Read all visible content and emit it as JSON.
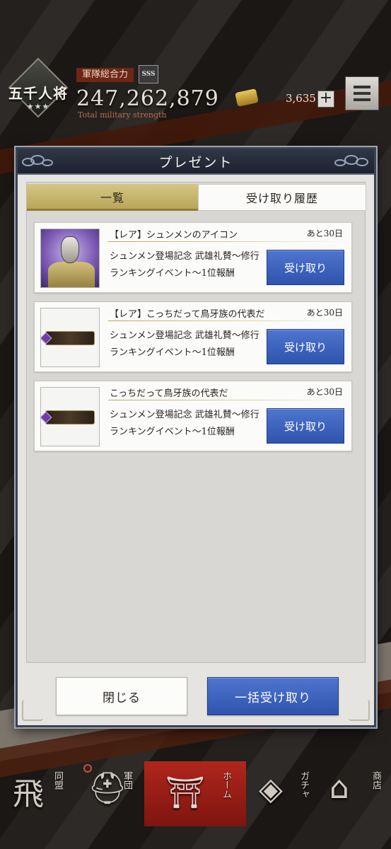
{
  "hud": {
    "rank": "五千人将",
    "rank_stars": "★★★",
    "power_label": "軍隊総合力",
    "power_grade": "SSS",
    "power_value": "247,262,879",
    "power_sub": "Total military strength",
    "coin_count": "3,635",
    "plus": "+"
  },
  "modal": {
    "title": "プレゼント",
    "tabs": [
      {
        "label": "一覧",
        "active": true
      },
      {
        "label": "受け取り履歴",
        "active": false
      }
    ],
    "items": [
      {
        "title": "【レア】シュンメンのアイコン",
        "expire": "あと30日",
        "desc": "シュンメン登場記念 武雄礼賛～修行ランキングイベント～1位報酬",
        "button": "受け取り",
        "thumb": "avatar-icon"
      },
      {
        "title": "【レア】こっちだって鳥牙族の代表だ",
        "expire": "あと30日",
        "desc": "シュンメン登場記念 武雄礼賛～修行ランキングイベント～1位報酬",
        "button": "受け取り",
        "thumb": "title-plate-icon"
      },
      {
        "title": "こっちだって鳥牙族の代表だ",
        "expire": "あと30日",
        "desc": "シュンメン登場記念 武雄礼賛～修行ランキングイベント～1位報酬",
        "button": "受け取り",
        "thumb": "title-plate-icon"
      }
    ],
    "close_label": "閉じる",
    "claim_all_label": "一括受け取り"
  },
  "nav": {
    "items": [
      {
        "label": "同盟",
        "icon": "flying-kanji-icon"
      },
      {
        "label": "軍団",
        "icon": "helmet-icon"
      },
      {
        "label": "ホーム",
        "icon": "palace-icon"
      },
      {
        "label": "ガチャ",
        "icon": "diamond-crest-icon"
      },
      {
        "label": "商店",
        "icon": "shop-building-icon"
      }
    ]
  },
  "colors": {
    "accent_blue": "#3a60bb",
    "tab_gold": "#c9b771",
    "modal_header": "#262c3a"
  }
}
